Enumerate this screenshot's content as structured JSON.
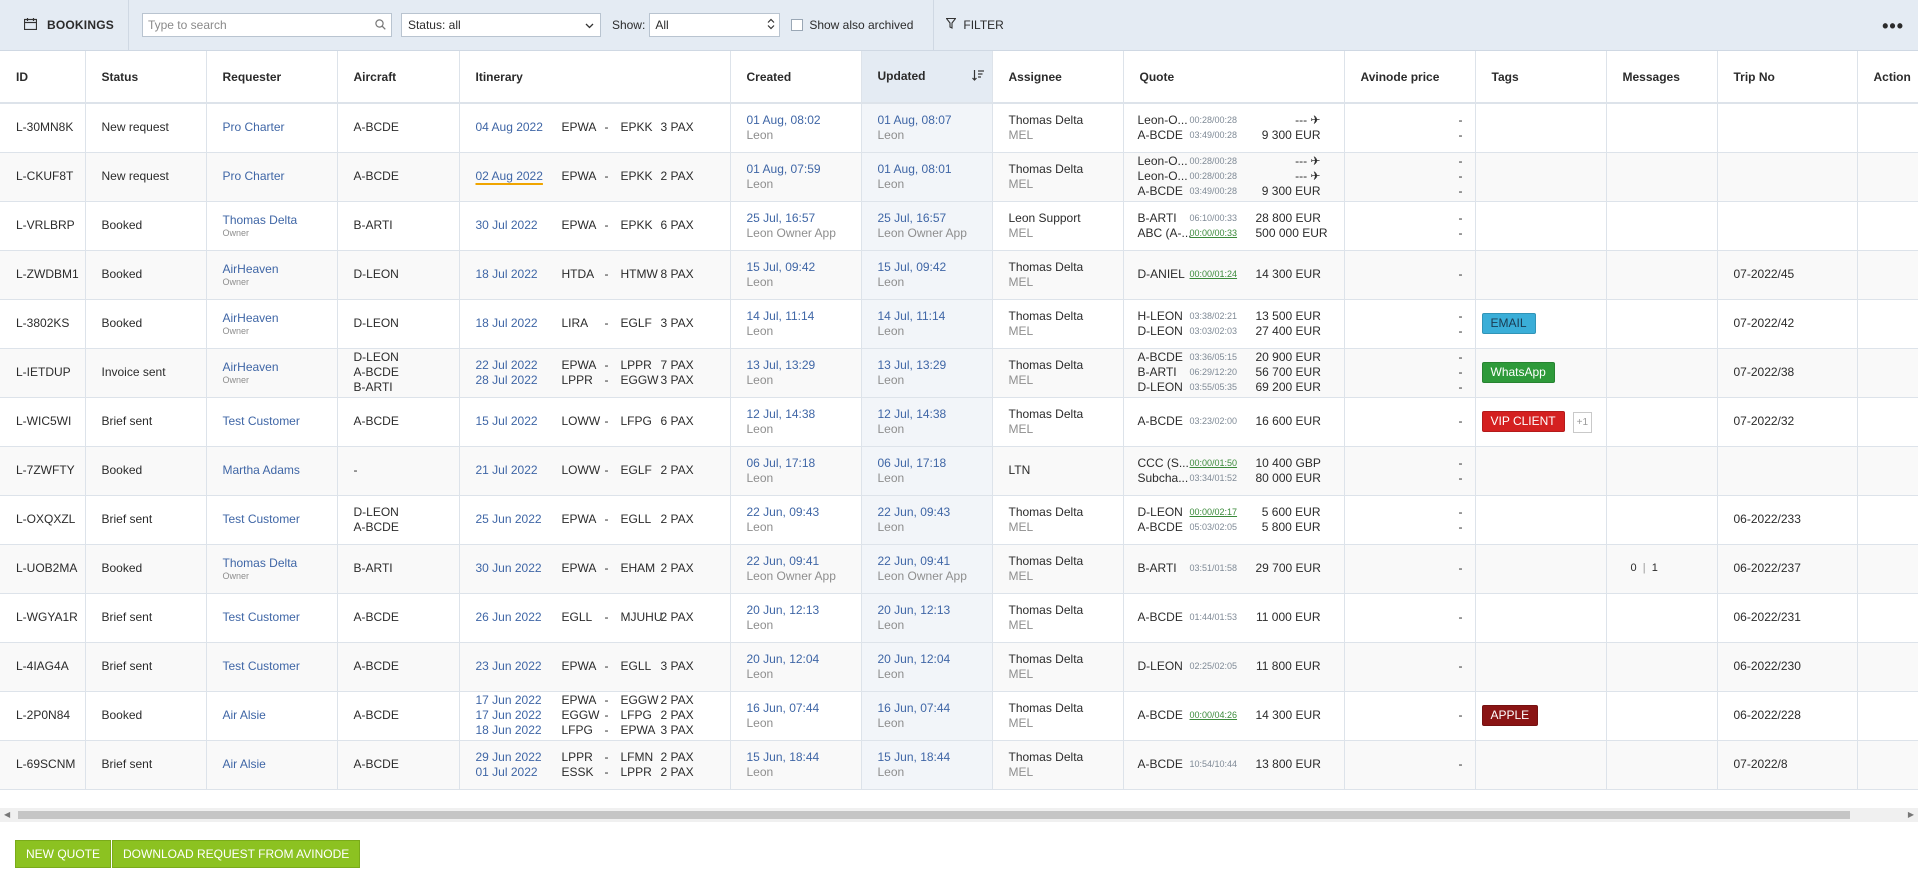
{
  "toolbar": {
    "title": "BOOKINGS",
    "search_placeholder": "Type to search",
    "status_select": "Status: all",
    "show_label": "Show:",
    "show_value": "All",
    "archived_label": "Show also archived",
    "filter_label": "FILTER",
    "more_label": "•••"
  },
  "columns": [
    "ID",
    "Status",
    "Requester",
    "Aircraft",
    "Itinerary",
    "Created",
    "Updated",
    "Assignee",
    "Quote",
    "Avinode price",
    "Tags",
    "Messages",
    "Trip No",
    "Action"
  ],
  "rows": [
    {
      "id": "L-30MN8K",
      "status": "New request",
      "requester": "Pro Charter",
      "requester_sub": "",
      "aircraft": [
        "A-BCDE"
      ],
      "itinerary": [
        {
          "date": "04 Aug 2022",
          "from": "EPWA",
          "to": "EPKK",
          "pax": "3 PAX"
        }
      ],
      "created": "01 Aug, 08:02",
      "created_by": "Leon",
      "updated": "01 Aug, 08:07",
      "updated_by": "Leon",
      "assignee": "Thomas Delta",
      "assignee_base": "MEL",
      "quotes": [
        {
          "ac": "Leon-O...",
          "tm": "00:28/00:28",
          "green": false,
          "pr": "--- ✈"
        },
        {
          "ac": "A-BCDE",
          "tm": "03:49/00:28",
          "green": false,
          "pr": "9 300 EUR"
        }
      ],
      "avinode": [
        "-",
        "-"
      ],
      "tag": null,
      "messages": null,
      "trip": ""
    },
    {
      "id": "L-CKUF8T",
      "status": "New request",
      "requester": "Pro Charter",
      "requester_sub": "",
      "aircraft": [
        "A-BCDE"
      ],
      "itinerary": [
        {
          "date": "02 Aug 2022",
          "from": "EPWA",
          "to": "EPKK",
          "pax": "2 PAX",
          "warn": true
        }
      ],
      "created": "01 Aug, 07:59",
      "created_by": "Leon",
      "updated": "01 Aug, 08:01",
      "updated_by": "Leon",
      "assignee": "Thomas Delta",
      "assignee_base": "MEL",
      "quotes": [
        {
          "ac": "Leon-O...",
          "tm": "00:28/00:28",
          "green": false,
          "pr": "--- ✈"
        },
        {
          "ac": "Leon-O...",
          "tm": "00:28/00:28",
          "green": false,
          "pr": "--- ✈"
        },
        {
          "ac": "A-BCDE",
          "tm": "03:49/00:28",
          "green": false,
          "pr": "9 300 EUR"
        }
      ],
      "avinode": [
        "-",
        "-",
        "-"
      ],
      "tag": null,
      "messages": null,
      "trip": ""
    },
    {
      "id": "L-VRLBRP",
      "status": "Booked",
      "requester": "Thomas Delta",
      "requester_sub": "Owner",
      "aircraft": [
        "B-ARTI"
      ],
      "itinerary": [
        {
          "date": "30 Jul 2022",
          "from": "EPWA",
          "to": "EPKK",
          "pax": "6 PAX"
        }
      ],
      "created": "25 Jul, 16:57",
      "created_by": "Leon Owner App",
      "updated": "25 Jul, 16:57",
      "updated_by": "Leon Owner App",
      "assignee": "Leon Support",
      "assignee_base": "MEL",
      "quotes": [
        {
          "ac": "B-ARTI",
          "tm": "06:10/00:33",
          "green": false,
          "pr": "28 800 EUR"
        },
        {
          "ac": "ABC (A-...",
          "tm": "00:00/00:33",
          "green": true,
          "pr": "500 000 EUR"
        }
      ],
      "avinode": [
        "-",
        "-"
      ],
      "tag": null,
      "messages": null,
      "trip": ""
    },
    {
      "id": "L-ZWDBM1",
      "status": "Booked",
      "requester": "AirHeaven",
      "requester_sub": "Owner",
      "aircraft": [
        "D-LEON"
      ],
      "itinerary": [
        {
          "date": "18 Jul 2022",
          "from": "HTDA",
          "to": "HTMW",
          "pax": "8 PAX"
        }
      ],
      "created": "15 Jul, 09:42",
      "created_by": "Leon",
      "updated": "15 Jul, 09:42",
      "updated_by": "Leon",
      "assignee": "Thomas Delta",
      "assignee_base": "MEL",
      "quotes": [
        {
          "ac": "D-ANIEL",
          "tm": "00:00/01:24",
          "green": true,
          "pr": "14 300 EUR"
        }
      ],
      "avinode": [
        "-"
      ],
      "tag": null,
      "messages": null,
      "trip": "07-2022/45"
    },
    {
      "id": "L-3802KS",
      "status": "Booked",
      "requester": "AirHeaven",
      "requester_sub": "Owner",
      "aircraft": [
        "D-LEON"
      ],
      "itinerary": [
        {
          "date": "18 Jul 2022",
          "from": "LIRA",
          "to": "EGLF",
          "pax": "3 PAX"
        }
      ],
      "created": "14 Jul, 11:14",
      "created_by": "Leon",
      "updated": "14 Jul, 11:14",
      "updated_by": "Leon",
      "assignee": "Thomas Delta",
      "assignee_base": "MEL",
      "quotes": [
        {
          "ac": "H-LEON",
          "tm": "03:38/02:21",
          "green": false,
          "pr": "13 500 EUR"
        },
        {
          "ac": "D-LEON",
          "tm": "03:03/02:03",
          "green": false,
          "pr": "27 400 EUR"
        }
      ],
      "avinode": [
        "-",
        "-"
      ],
      "tag": {
        "label": "EMAIL",
        "color": "#3aaed8",
        "text": "#1b3b52"
      },
      "messages": null,
      "trip": "07-2022/42"
    },
    {
      "id": "L-IETDUP",
      "status": "Invoice sent",
      "requester": "AirHeaven",
      "requester_sub": "Owner",
      "aircraft": [
        "D-LEON",
        "A-BCDE",
        "B-ARTI"
      ],
      "itinerary": [
        {
          "date": "22 Jul 2022",
          "from": "EPWA",
          "to": "LPPR",
          "pax": "7 PAX"
        },
        {
          "date": "28 Jul 2022",
          "from": "LPPR",
          "to": "EGGW",
          "pax": "3 PAX"
        }
      ],
      "created": "13 Jul, 13:29",
      "created_by": "Leon",
      "updated": "13 Jul, 13:29",
      "updated_by": "Leon",
      "assignee": "Thomas Delta",
      "assignee_base": "MEL",
      "quotes": [
        {
          "ac": "A-BCDE",
          "tm": "03:36/05:15",
          "green": false,
          "pr": "20 900 EUR"
        },
        {
          "ac": "B-ARTI",
          "tm": "06:29/12:20",
          "green": false,
          "pr": "56 700 EUR"
        },
        {
          "ac": "D-LEON",
          "tm": "03:55/05:35",
          "green": false,
          "pr": "69 200 EUR"
        }
      ],
      "avinode": [
        "-",
        "-",
        "-"
      ],
      "tag": {
        "label": "WhatsApp",
        "color": "#2e9a3a",
        "text": "#ffffff"
      },
      "messages": null,
      "trip": "07-2022/38"
    },
    {
      "id": "L-WIC5WI",
      "status": "Brief sent",
      "requester": "Test Customer",
      "requester_sub": "",
      "aircraft": [
        "A-BCDE"
      ],
      "itinerary": [
        {
          "date": "15 Jul 2022",
          "from": "LOWW",
          "to": "LFPG",
          "pax": "6 PAX"
        }
      ],
      "created": "12 Jul, 14:38",
      "created_by": "Leon",
      "updated": "12 Jul, 14:38",
      "updated_by": "Leon",
      "assignee": "Thomas Delta",
      "assignee_base": "MEL",
      "quotes": [
        {
          "ac": "A-BCDE",
          "tm": "03:23/02:00",
          "green": false,
          "pr": "16 600 EUR"
        }
      ],
      "avinode": [
        "-"
      ],
      "tag": {
        "label": "VIP CLIENT",
        "color": "#d42020",
        "text": "#ffffff",
        "plus": "+1"
      },
      "messages": null,
      "trip": "07-2022/32"
    },
    {
      "id": "L-7ZWFTY",
      "status": "Booked",
      "requester": "Martha Adams",
      "requester_sub": "",
      "aircraft": [
        "-"
      ],
      "itinerary": [
        {
          "date": "21 Jul 2022",
          "from": "LOWW",
          "to": "EGLF",
          "pax": "2 PAX"
        }
      ],
      "created": "06 Jul, 17:18",
      "created_by": "Leon",
      "updated": "06 Jul, 17:18",
      "updated_by": "Leon",
      "assignee": "LTN",
      "assignee_base": "",
      "quotes": [
        {
          "ac": "CCC (S...",
          "tm": "00:00/01:50",
          "green": true,
          "pr": "10 400 GBP"
        },
        {
          "ac": "Subcha...",
          "tm": "03:34/01:52",
          "green": false,
          "pr": "80 000 EUR"
        }
      ],
      "avinode": [
        "-",
        "-"
      ],
      "tag": null,
      "messages": null,
      "trip": ""
    },
    {
      "id": "L-OXQXZL",
      "status": "Brief sent",
      "requester": "Test Customer",
      "requester_sub": "",
      "aircraft": [
        "D-LEON",
        "A-BCDE"
      ],
      "itinerary": [
        {
          "date": "25 Jun 2022",
          "from": "EPWA",
          "to": "EGLL",
          "pax": "2 PAX"
        }
      ],
      "created": "22 Jun, 09:43",
      "created_by": "Leon",
      "updated": "22 Jun, 09:43",
      "updated_by": "Leon",
      "assignee": "Thomas Delta",
      "assignee_base": "MEL",
      "quotes": [
        {
          "ac": "D-LEON",
          "tm": "00:00/02:17",
          "green": true,
          "pr": "5 600 EUR"
        },
        {
          "ac": "A-BCDE",
          "tm": "05:03/02:05",
          "green": false,
          "pr": "5 800 EUR"
        }
      ],
      "avinode": [
        "-",
        "-"
      ],
      "tag": null,
      "messages": null,
      "trip": "06-2022/233"
    },
    {
      "id": "L-UOB2MA",
      "status": "Booked",
      "requester": "Thomas Delta",
      "requester_sub": "Owner",
      "aircraft": [
        "B-ARTI"
      ],
      "itinerary": [
        {
          "date": "30 Jun 2022",
          "from": "EPWA",
          "to": "EHAM",
          "pax": "2 PAX"
        }
      ],
      "created": "22 Jun, 09:41",
      "created_by": "Leon Owner App",
      "updated": "22 Jun, 09:41",
      "updated_by": "Leon Owner App",
      "assignee": "Thomas Delta",
      "assignee_base": "MEL",
      "quotes": [
        {
          "ac": "B-ARTI",
          "tm": "03:51/01:58",
          "green": false,
          "pr": "29 700 EUR"
        }
      ],
      "avinode": [
        "-"
      ],
      "tag": null,
      "messages": {
        "a": "0",
        "b": "1"
      },
      "trip": "06-2022/237"
    },
    {
      "id": "L-WGYA1R",
      "status": "Brief sent",
      "requester": "Test Customer",
      "requester_sub": "",
      "aircraft": [
        "A-BCDE"
      ],
      "itinerary": [
        {
          "date": "26 Jun 2022",
          "from": "EGLL",
          "to": "MJUHU",
          "pax": "2 PAX"
        }
      ],
      "created": "20 Jun, 12:13",
      "created_by": "Leon",
      "updated": "20 Jun, 12:13",
      "updated_by": "Leon",
      "assignee": "Thomas Delta",
      "assignee_base": "MEL",
      "quotes": [
        {
          "ac": "A-BCDE",
          "tm": "01:44/01:53",
          "green": false,
          "pr": "11 000 EUR"
        }
      ],
      "avinode": [
        "-"
      ],
      "tag": null,
      "messages": null,
      "trip": "06-2022/231"
    },
    {
      "id": "L-4IAG4A",
      "status": "Brief sent",
      "requester": "Test Customer",
      "requester_sub": "",
      "aircraft": [
        "A-BCDE"
      ],
      "itinerary": [
        {
          "date": "23 Jun 2022",
          "from": "EPWA",
          "to": "EGLL",
          "pax": "3 PAX"
        }
      ],
      "created": "20 Jun, 12:04",
      "created_by": "Leon",
      "updated": "20 Jun, 12:04",
      "updated_by": "Leon",
      "assignee": "Thomas Delta",
      "assignee_base": "MEL",
      "quotes": [
        {
          "ac": "D-LEON",
          "tm": "02:25/02:05",
          "green": false,
          "pr": "11 800 EUR"
        }
      ],
      "avinode": [
        "-"
      ],
      "tag": null,
      "messages": null,
      "trip": "06-2022/230"
    },
    {
      "id": "L-2P0N84",
      "status": "Booked",
      "requester": "Air Alsie",
      "requester_sub": "",
      "aircraft": [
        "A-BCDE"
      ],
      "itinerary": [
        {
          "date": "17 Jun 2022",
          "from": "EPWA",
          "to": "EGGW",
          "pax": "2 PAX"
        },
        {
          "date": "17 Jun 2022",
          "from": "EGGW",
          "to": "LFPG",
          "pax": "2 PAX"
        },
        {
          "date": "18 Jun 2022",
          "from": "LFPG",
          "to": "EPWA",
          "pax": "3 PAX"
        }
      ],
      "created": "16 Jun, 07:44",
      "created_by": "Leon",
      "updated": "16 Jun, 07:44",
      "updated_by": "Leon",
      "assignee": "Thomas Delta",
      "assignee_base": "MEL",
      "quotes": [
        {
          "ac": "A-BCDE",
          "tm": "00:00/04:26",
          "green": true,
          "pr": "14 300 EUR"
        }
      ],
      "avinode": [
        "-"
      ],
      "tag": {
        "label": "APPLE",
        "color": "#8a1414",
        "text": "#ffffff"
      },
      "messages": null,
      "trip": "06-2022/228"
    },
    {
      "id": "L-69SCNM",
      "status": "Brief sent",
      "requester": "Air Alsie",
      "requester_sub": "",
      "aircraft": [
        "A-BCDE"
      ],
      "itinerary": [
        {
          "date": "29 Jun 2022",
          "from": "LPPR",
          "to": "LFMN",
          "pax": "2 PAX"
        },
        {
          "date": "01 Jul 2022",
          "from": "ESSK",
          "to": "LPPR",
          "pax": "2 PAX"
        }
      ],
      "created": "15 Jun, 18:44",
      "created_by": "Leon",
      "updated": "15 Jun, 18:44",
      "updated_by": "Leon",
      "assignee": "Thomas Delta",
      "assignee_base": "MEL",
      "quotes": [
        {
          "ac": "A-BCDE",
          "tm": "10:54/10:44",
          "green": false,
          "pr": "13 800 EUR"
        }
      ],
      "avinode": [
        "-"
      ],
      "tag": null,
      "messages": null,
      "trip": "07-2022/8"
    }
  ],
  "footer": {
    "new_quote": "NEW QUOTE",
    "download": "DOWNLOAD REQUEST FROM AVINODE"
  }
}
